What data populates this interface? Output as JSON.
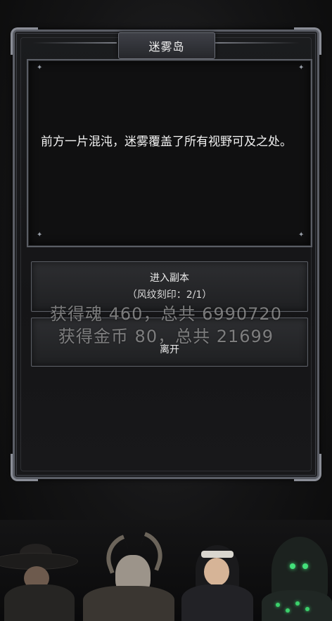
{
  "dialog": {
    "title": "迷雾岛",
    "description": "前方一片混沌，迷雾覆盖了所有视野可及之处。"
  },
  "actions": {
    "enter_label": "进入副本",
    "enter_sub": "（风纹刻印：2/1）",
    "leave_label": "离开"
  },
  "toasts": {
    "souls": "获得魂 460，总共 6990720",
    "gold": "获得金币 80，总共 21699"
  },
  "colors": {
    "frame": "#5b5e66",
    "panel": "#101011",
    "text": "#f2f2f2",
    "hero_eye_glow": "#43e07a"
  },
  "icons": [
    "spark-icon"
  ]
}
